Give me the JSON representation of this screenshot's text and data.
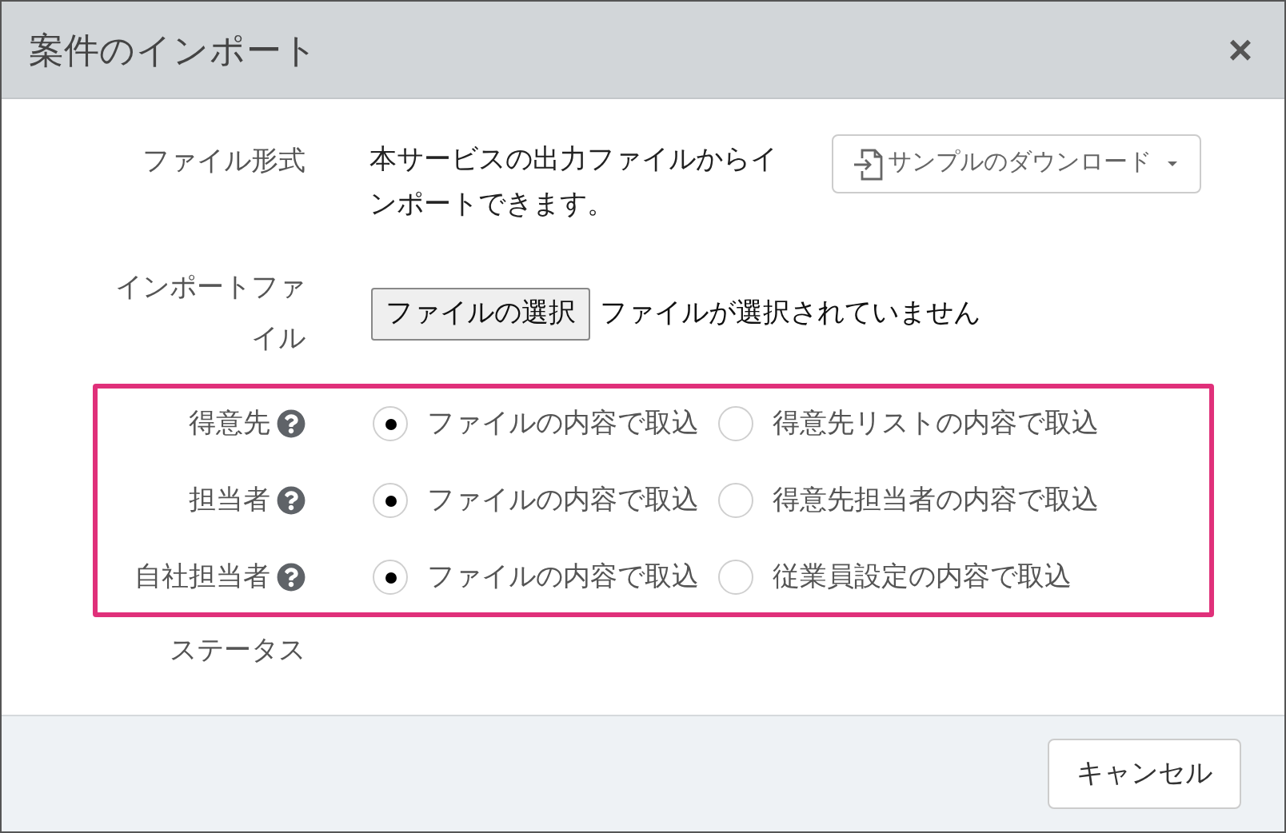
{
  "dialog": {
    "title": "案件のインポート",
    "close": "×"
  },
  "file_format": {
    "label": "ファイル形式",
    "description": "本サービスの出力ファイルからインポートできます。",
    "download_button": "サンプルのダウンロード"
  },
  "import_file": {
    "label": "インポートファイル",
    "choose_button": "ファイルの選択",
    "status": "ファイルが選択されていません"
  },
  "options": [
    {
      "label": "得意先",
      "choices": [
        {
          "label": "ファイルの内容で取込",
          "selected": true
        },
        {
          "label": "得意先リストの内容で取込",
          "selected": false
        }
      ]
    },
    {
      "label": "担当者",
      "choices": [
        {
          "label": "ファイルの内容で取込",
          "selected": true
        },
        {
          "label": "得意先担当者の内容で取込",
          "selected": false
        }
      ]
    },
    {
      "label": "自社担当者",
      "choices": [
        {
          "label": "ファイルの内容で取込",
          "selected": true
        },
        {
          "label": "従業員設定の内容で取込",
          "selected": false
        }
      ]
    }
  ],
  "status_label": "ステータス",
  "footer": {
    "cancel": "キャンセル"
  }
}
